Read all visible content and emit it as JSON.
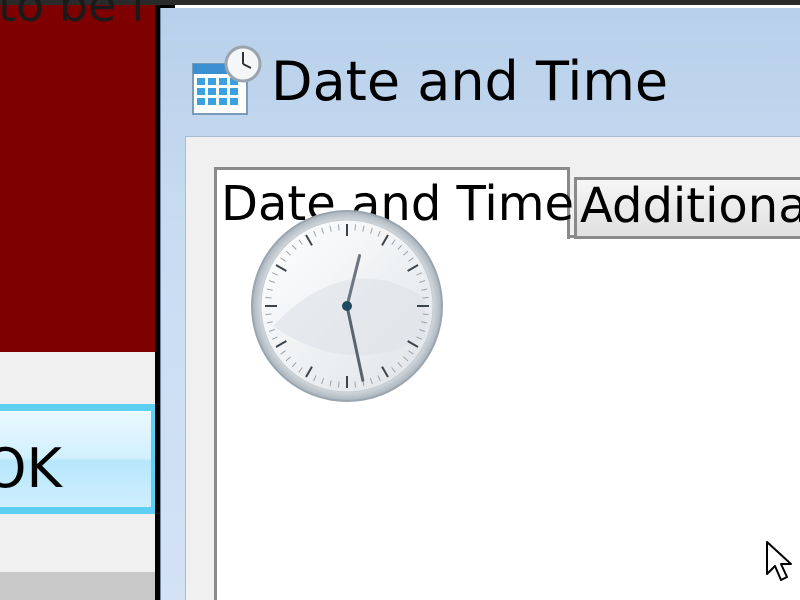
{
  "background_window": {
    "title_fragment": "to be f",
    "ok_button_label": "OK"
  },
  "dialog": {
    "title": "Date and Time",
    "title_icon": "date-time-calendar-clock-icon",
    "tabs": [
      {
        "label": "Date and Time",
        "active": true
      },
      {
        "label": "Additional Clocks",
        "active": false
      }
    ],
    "clock": {
      "hour": 12,
      "minute": 28
    }
  },
  "cursor": {
    "icon": "mouse-pointer-arrow-icon"
  },
  "colors": {
    "background_panel_red": "#7f0000",
    "ok_button_blue": "#5ccff2",
    "dialog_frame_blue": "#c9dcf1"
  }
}
